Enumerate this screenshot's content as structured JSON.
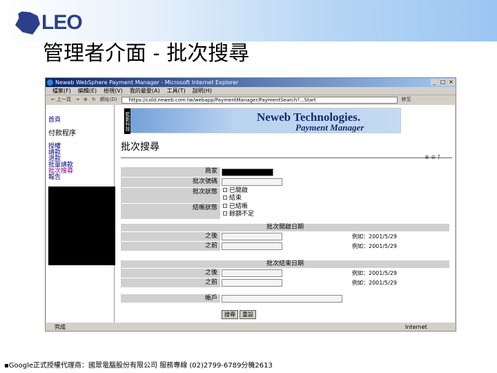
{
  "slide": {
    "logo_text": "LEO",
    "title": "管理者介面 - 批次搜尋",
    "footer": "▪Google正式授權代理商：國眾電腦股份有限公司 服務專線 (02)2799-6789分機2613"
  },
  "browser": {
    "window_title": "Neweb WebSphere Payment Manager - Microsoft Internet Explorer",
    "menu": [
      "檔案(F)",
      "編輯(E)",
      "檢視(V)",
      "我的最愛(A)",
      "工具(T)",
      "說明(H)"
    ],
    "toolbar": {
      "back": "上一頁",
      "address_label": "網址(D)",
      "address": "https://cold.neweb.com.tw/webapp/PaymentManager/PaymentSearch?...Start",
      "go": "移至"
    },
    "status": "完成",
    "zone": "Internet"
  },
  "sidebar": {
    "items": [
      "首頁",
      "付款程序",
      "授權",
      "請款",
      "退款",
      "批量請款",
      "批次搜尋",
      "報告"
    ]
  },
  "banner": {
    "title": "Neweb Technologies.",
    "subtitle": "Payment Manager",
    "side": "藍新科技"
  },
  "page": {
    "heading": "批次搜尋",
    "fields": {
      "merchant": "商家",
      "batch_no": "批次號碼",
      "batch_status": "批次狀態",
      "batch_opt1": "已開啟",
      "batch_opt2": "結束",
      "settle_status": "結帳狀態",
      "settle_opt1": "已結帳",
      "settle_opt2": "餘額不足"
    },
    "open_date": {
      "title": "批次開啟日期",
      "after": "之後",
      "before": "之前",
      "ex_after": "例如：2001/5/29",
      "ex_before": "例如：2001/5/29"
    },
    "close_date": {
      "title": "批次結束日期",
      "after": "之後",
      "before": "之前",
      "ex_after": "例如：2001/5/29",
      "ex_before": "例如：2001/5/29"
    },
    "account": "帳戶",
    "search_button": "搜尋",
    "reset_button": "重設"
  }
}
